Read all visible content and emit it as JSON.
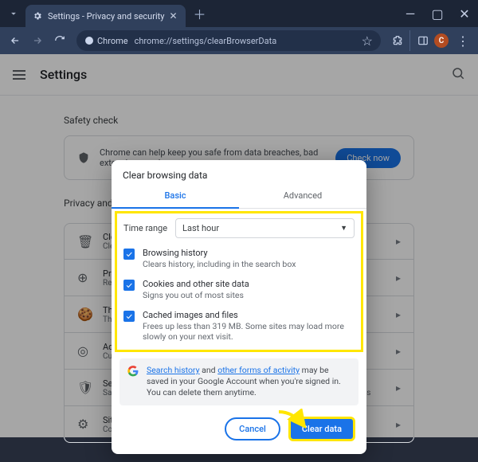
{
  "window": {
    "tab_title": "Settings - Privacy and security",
    "minimize": "—",
    "maximize": "▢",
    "close": "✕",
    "chrome_chip": "Chrome",
    "url": "chrome://settings/clearBrowserData",
    "profile_initial": "C"
  },
  "settings": {
    "heading": "Settings",
    "safety_check_label": "Safety check",
    "safety_check_text": "Chrome can help keep you safe from data breaches, bad extensions, and more",
    "check_now": "Check now",
    "privacy_label": "Privacy and security",
    "rows": [
      {
        "t1": "Clear browsing data",
        "t2": "Clear history, cookies, cache, and more"
      },
      {
        "t1": "Privacy Guide",
        "t2": "Review key privacy and security controls"
      },
      {
        "t1": "Third-party cookies",
        "t2": "Third-party cookies are blocked in Incognito mode"
      },
      {
        "t1": "Ad privacy",
        "t2": "Customize the info used by sites to show you ads"
      },
      {
        "t1": "Security",
        "t2": "Safe Browsing (protection from dangerous sites) and other security settings"
      },
      {
        "t1": "Site settings",
        "t2": "Controls what information sites can use and show"
      }
    ]
  },
  "dialog": {
    "title": "Clear browsing data",
    "tab_basic": "Basic",
    "tab_advanced": "Advanced",
    "time_range_label": "Time range",
    "time_range_value": "Last hour",
    "options": [
      {
        "a": "Browsing history",
        "b": "Clears history, including in the search box"
      },
      {
        "a": "Cookies and other site data",
        "b": "Signs you out of most sites"
      },
      {
        "a": "Cached images and files",
        "b": "Frees up less than 319 MB. Some sites may load more slowly on your next visit."
      }
    ],
    "info_prefix": " ",
    "info_link1": "Search history",
    "info_mid": " and ",
    "info_link2": "other forms of activity",
    "info_suffix": " may be saved in your Google Account when you're signed in. You can delete them anytime.",
    "cancel": "Cancel",
    "clear": "Clear data"
  }
}
